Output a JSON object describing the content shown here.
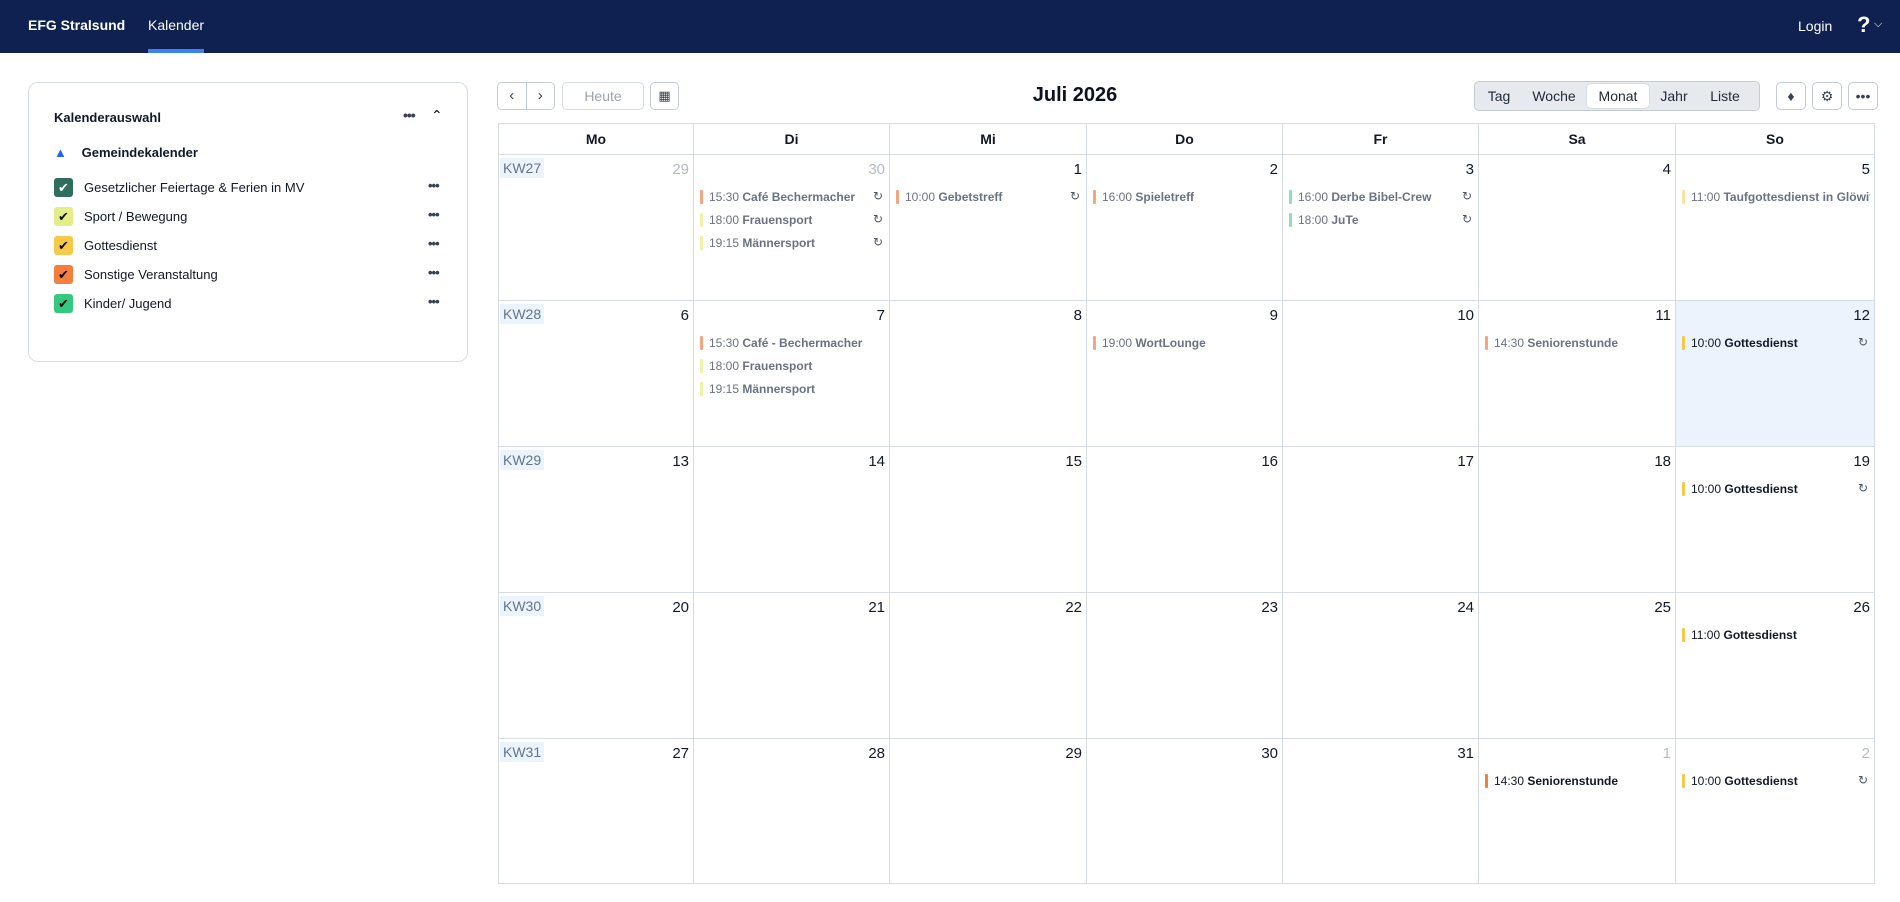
{
  "nav": {
    "brand": "EFG Stralsund",
    "active_link": "Kalender",
    "login": "Login",
    "help": "?"
  },
  "sidebar": {
    "title": "Kalenderauswahl",
    "main_calendar": "Gemeindekalender",
    "calendars": [
      {
        "label": "Gesetzlicher Feiertage & Ferien in MV",
        "color": "#2f6e5c",
        "checked": true
      },
      {
        "label": "Sport / Bewegung",
        "color": "#e3ef86",
        "checked": true
      },
      {
        "label": "Gottesdienst",
        "color": "#f7c948",
        "checked": true
      },
      {
        "label": "Sonstige Veranstaltung",
        "color": "#f47e3e",
        "checked": true
      },
      {
        "label": "Kinder/ Jugend",
        "color": "#34c97e",
        "checked": true
      }
    ]
  },
  "toolbar": {
    "today_label": "Heute",
    "title": "Juli 2026",
    "views": [
      "Tag",
      "Woche",
      "Monat",
      "Jahr",
      "Liste"
    ],
    "active_view": "Monat"
  },
  "calendar": {
    "weekdays": [
      "Mo",
      "Di",
      "Mi",
      "Do",
      "Fr",
      "Sa",
      "So"
    ],
    "weeks": [
      {
        "kw": "KW27",
        "days": [
          {
            "num": "29",
            "muted": true,
            "events": []
          },
          {
            "num": "30",
            "muted": true,
            "events": [
              {
                "time": "15:30",
                "title": "Café Bechermacher",
                "color": "#f4a582",
                "repeat": true
              },
              {
                "time": "18:00",
                "title": "Frauensport",
                "color": "#eef2a4",
                "repeat": true
              },
              {
                "time": "19:15",
                "title": "Männersport",
                "color": "#eef2a4",
                "repeat": true
              }
            ]
          },
          {
            "num": "1",
            "events": [
              {
                "time": "10:00",
                "title": "Gebetstreff",
                "color": "#f4a582",
                "repeat": true
              }
            ]
          },
          {
            "num": "2",
            "events": [
              {
                "time": "16:00",
                "title": "Spieletreff",
                "color": "#f4a582"
              }
            ]
          },
          {
            "num": "3",
            "events": [
              {
                "time": "16:00",
                "title": "Derbe Bibel-Crew",
                "color": "#8fe0b7",
                "repeat": true
              },
              {
                "time": "18:00",
                "title": "JuTe",
                "color": "#8fe0b7",
                "repeat": true
              }
            ]
          },
          {
            "num": "4",
            "events": []
          },
          {
            "num": "5",
            "events": [
              {
                "time": "11:00",
                "title": "Taufgottesdienst in Glöwitz",
                "color": "#fbe29a"
              }
            ]
          }
        ]
      },
      {
        "kw": "KW28",
        "days": [
          {
            "num": "6",
            "events": []
          },
          {
            "num": "7",
            "events": [
              {
                "time": "15:30",
                "title": "Café - Bechermacher",
                "color": "#f4a582"
              },
              {
                "time": "18:00",
                "title": "Frauensport",
                "color": "#eef2a4"
              },
              {
                "time": "19:15",
                "title": "Männersport",
                "color": "#eef2a4"
              }
            ]
          },
          {
            "num": "8",
            "events": []
          },
          {
            "num": "9",
            "events": [
              {
                "time": "19:00",
                "title": "WortLounge",
                "color": "#f4a582"
              }
            ]
          },
          {
            "num": "10",
            "events": []
          },
          {
            "num": "11",
            "events": [
              {
                "time": "14:30",
                "title": "Seniorenstunde",
                "color": "#f4a582"
              }
            ]
          },
          {
            "num": "12",
            "today": true,
            "events": [
              {
                "time": "10:00",
                "title": "Gottesdienst",
                "color": "#f7c948",
                "repeat": true,
                "strong": true
              }
            ]
          }
        ]
      },
      {
        "kw": "KW29",
        "days": [
          {
            "num": "13",
            "events": []
          },
          {
            "num": "14",
            "events": []
          },
          {
            "num": "15",
            "events": []
          },
          {
            "num": "16",
            "events": []
          },
          {
            "num": "17",
            "events": []
          },
          {
            "num": "18",
            "events": []
          },
          {
            "num": "19",
            "events": [
              {
                "time": "10:00",
                "title": "Gottesdienst",
                "color": "#f7c948",
                "repeat": true,
                "strong": true
              }
            ]
          }
        ]
      },
      {
        "kw": "KW30",
        "days": [
          {
            "num": "20",
            "events": []
          },
          {
            "num": "21",
            "events": []
          },
          {
            "num": "22",
            "events": []
          },
          {
            "num": "23",
            "events": []
          },
          {
            "num": "24",
            "events": []
          },
          {
            "num": "25",
            "events": []
          },
          {
            "num": "26",
            "events": [
              {
                "time": "11:00",
                "title": "Gottesdienst",
                "color": "#f7c948",
                "strong": true
              }
            ]
          }
        ]
      },
      {
        "kw": "KW31",
        "days": [
          {
            "num": "27",
            "events": []
          },
          {
            "num": "28",
            "events": []
          },
          {
            "num": "29",
            "events": []
          },
          {
            "num": "30",
            "events": []
          },
          {
            "num": "31",
            "events": []
          },
          {
            "num": "1",
            "muted": true,
            "events": [
              {
                "time": "14:30",
                "title": "Seniorenstunde",
                "color": "#f47e3e",
                "strong": true
              }
            ]
          },
          {
            "num": "2",
            "muted": true,
            "events": [
              {
                "time": "10:00",
                "title": "Gottesdienst",
                "color": "#f7c948",
                "repeat": true,
                "strong": true
              }
            ]
          }
        ]
      }
    ]
  }
}
